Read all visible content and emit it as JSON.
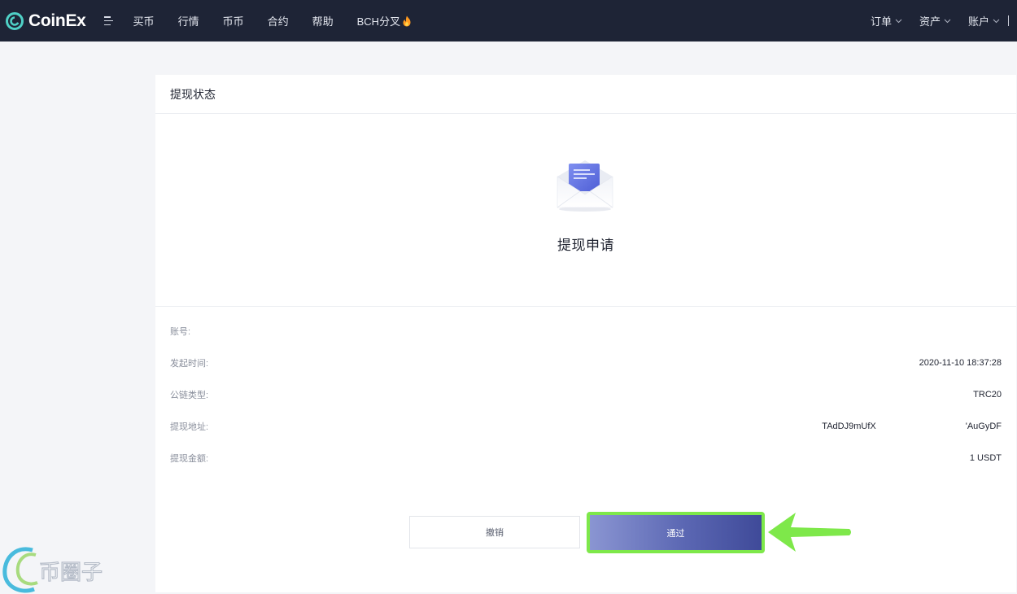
{
  "brand": {
    "name": "CoinEx",
    "accent": "#4fd0c6"
  },
  "nav": {
    "items": [
      "买币",
      "行情",
      "币币",
      "合约",
      "帮助",
      "BCH分叉"
    ]
  },
  "right_nav": {
    "items": [
      "订单",
      "资产",
      "账户"
    ]
  },
  "card": {
    "title": "提现状态",
    "status_icon": "envelope-icon",
    "status_text": "提现申请"
  },
  "info": {
    "account_label": "账号:",
    "account_value": "",
    "time_label": "发起时间:",
    "time_value": "2020-11-10 18:37:28",
    "chain_label": "公链类型:",
    "chain_value": "TRC20",
    "address_label": "提现地址:",
    "address_part1": "TAdDJ9mUfX",
    "address_part2": "'AuGyDF",
    "amount_label": "提现金额:",
    "amount_value": "1 USDT"
  },
  "actions": {
    "cancel_label": "撤销",
    "approve_label": "通过"
  },
  "watermark": {
    "text": "币圈子"
  },
  "colors": {
    "topbar": "#1e2436",
    "highlight": "#7ee84a",
    "approve_gradient_start": "#8a95d2",
    "approve_gradient_end": "#3f4a99"
  }
}
